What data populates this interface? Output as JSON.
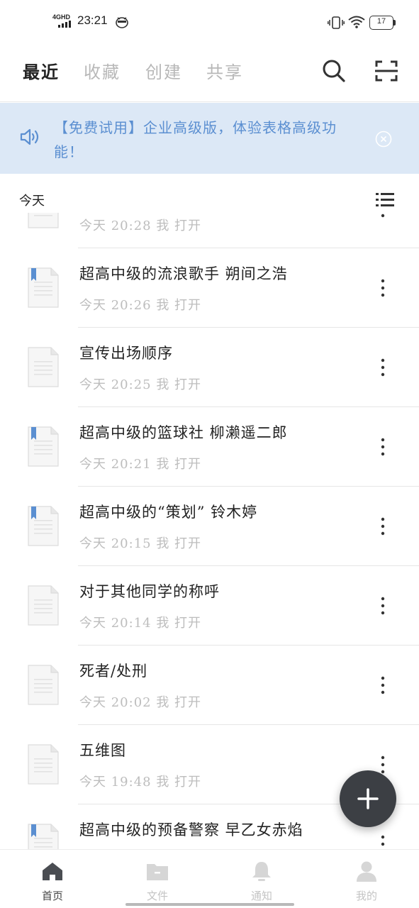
{
  "status_bar": {
    "network": "4GHD",
    "time": "23:21",
    "battery": "17"
  },
  "tabs": [
    {
      "label": "最近",
      "active": true
    },
    {
      "label": "收藏",
      "active": false
    },
    {
      "label": "创建",
      "active": false
    },
    {
      "label": "共享",
      "active": false
    }
  ],
  "banner": {
    "text": "【免费试用】企业高级版，体验表格高级功能！",
    "accent_color": "#5b8fd1",
    "background": "#dce8f6"
  },
  "section": {
    "title": "今天"
  },
  "files": [
    {
      "name": "",
      "meta": "今天 20:28 我 打开",
      "bookmarked": false,
      "partial": true
    },
    {
      "name": "超高中级的流浪歌手 朔间之浩",
      "meta": "今天 20:26 我 打开",
      "bookmarked": true
    },
    {
      "name": "宣传出场顺序",
      "meta": "今天 20:25 我 打开",
      "bookmarked": false
    },
    {
      "name": "超高中级的篮球社 柳濑遥二郎",
      "meta": "今天 20:21 我 打开",
      "bookmarked": true
    },
    {
      "name": "超高中级的“策划” 铃木婷",
      "meta": "今天 20:15 我 打开",
      "bookmarked": true
    },
    {
      "name": "对于其他同学的称呼",
      "meta": "今天 20:14 我 打开",
      "bookmarked": false
    },
    {
      "name": "死者/处刑",
      "meta": "今天 20:02 我 打开",
      "bookmarked": false
    },
    {
      "name": "五维图",
      "meta": "今天 19:48 我 打开",
      "bookmarked": false
    },
    {
      "name": "超高中级的预备警察 早乙女赤焰",
      "meta": "",
      "bookmarked": true
    }
  ],
  "fab": {
    "icon": "plus-icon"
  },
  "bottom_nav": [
    {
      "label": "首页",
      "icon": "home-icon",
      "active": true
    },
    {
      "label": "文件",
      "icon": "folder-icon",
      "active": false
    },
    {
      "label": "通知",
      "icon": "bell-icon",
      "active": false
    },
    {
      "label": "我的",
      "icon": "person-icon",
      "active": false
    }
  ]
}
